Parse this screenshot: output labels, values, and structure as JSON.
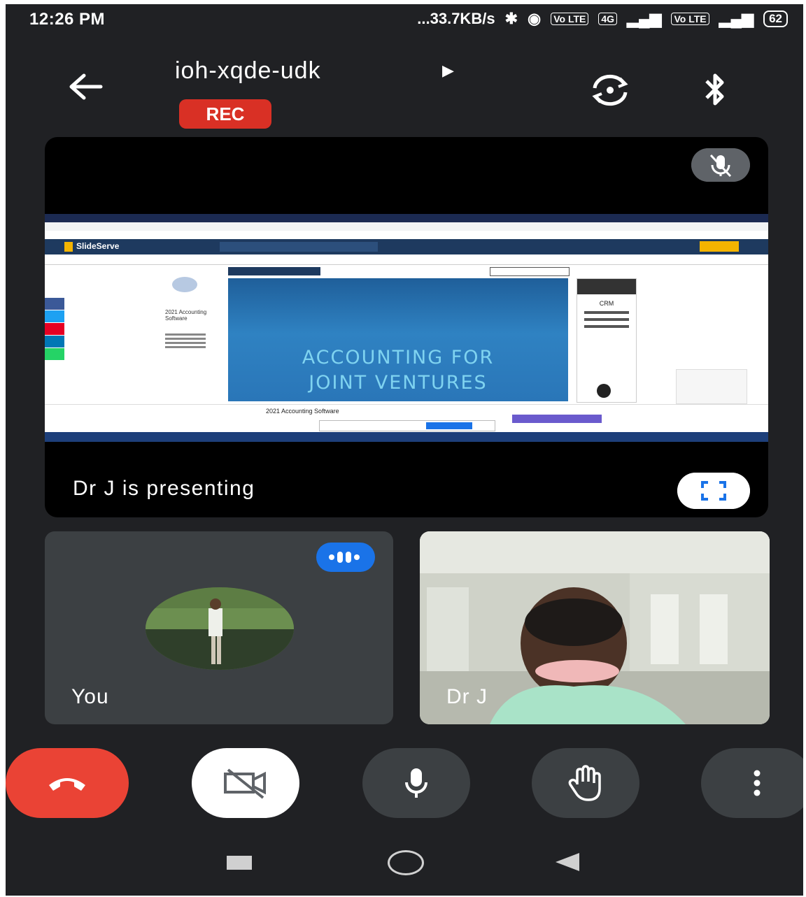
{
  "status_bar": {
    "time": "12:26 PM",
    "network_speed": "...33.7KB/s",
    "volte_1": "Vo LTE",
    "signal_4g": "4G",
    "volte_2": "Vo LTE",
    "battery": "62"
  },
  "header": {
    "meeting_code": "ioh-xqde-udk",
    "rec_label": "REC"
  },
  "presentation": {
    "presenting_text": "Dr J is presenting",
    "shared_screen": {
      "site_name": "SlideServe",
      "slide_title_line1": "ACCOUNTING FOR",
      "slide_title_line2": "JOINT VENTURES",
      "side_heading": "2021 Accounting Software",
      "ad_heading": "CRM",
      "bottom_ad_text": "2021 Accounting Software"
    }
  },
  "participants": [
    {
      "label": "You"
    },
    {
      "label": "Dr J"
    }
  ],
  "colors": {
    "background": "#202124",
    "tile": "#3c4043",
    "end_call": "#ea4335",
    "rec": "#d93025",
    "speaking": "#1a73e8"
  }
}
